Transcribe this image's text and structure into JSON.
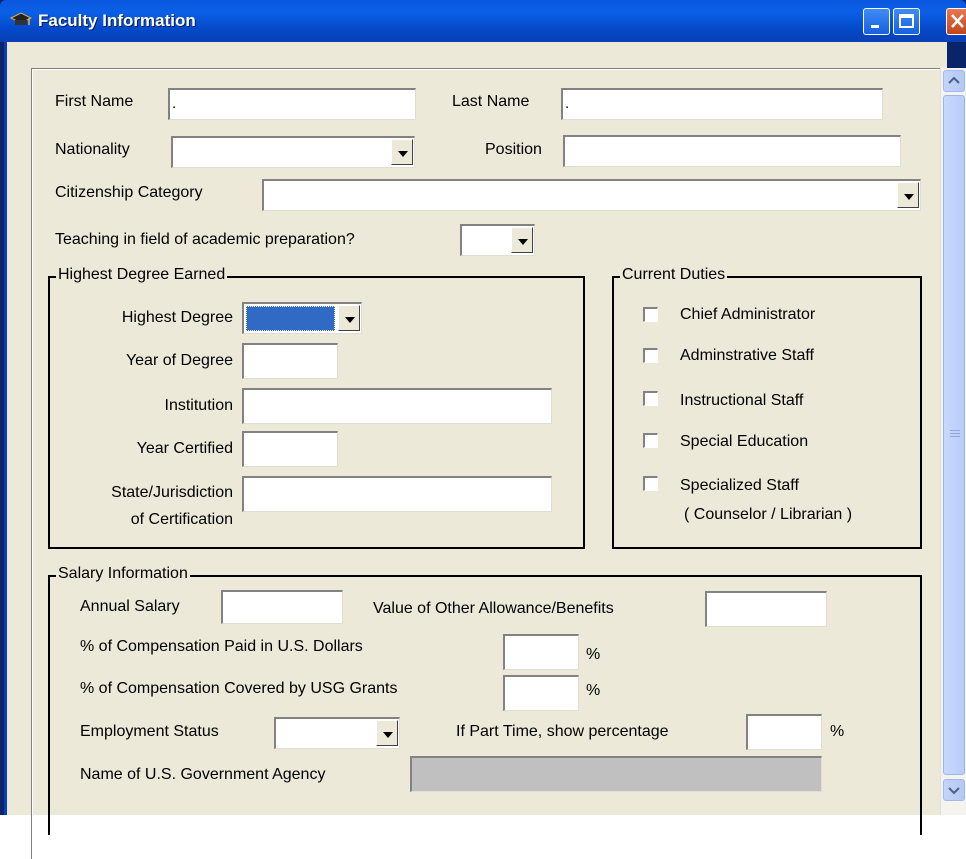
{
  "window": {
    "title": "Faculty Information",
    "icon": "graduation-cap-icon"
  },
  "fields": {
    "first_name": {
      "label": "First Name",
      "value": "."
    },
    "last_name": {
      "label": "Last Name",
      "value": "."
    },
    "nationality": {
      "label": "Nationality",
      "value": ""
    },
    "position": {
      "label": "Position",
      "value": ""
    },
    "citizenship": {
      "label": "Citizenship Category",
      "value": ""
    },
    "teaching_field": {
      "label": "Teaching in field of academic preparation?",
      "value": ""
    }
  },
  "degree": {
    "title": "Highest Degree Earned",
    "highest_degree": {
      "label": "Highest Degree",
      "value": ""
    },
    "year_of_degree": {
      "label": "Year of Degree",
      "value": ""
    },
    "institution": {
      "label": "Institution",
      "value": ""
    },
    "year_certified": {
      "label": "Year Certified",
      "value": ""
    },
    "state_line1": "State/Jurisdiction",
    "state_line2": "of Certification",
    "state_value": ""
  },
  "duties": {
    "title": "Current Duties",
    "items": [
      {
        "label": "Chief Administrator"
      },
      {
        "label": "Adminstrative Staff"
      },
      {
        "label": "Instructional Staff"
      },
      {
        "label": "Special Education"
      },
      {
        "label": "Specialized Staff",
        "sub": "( Counselor / Librarian )"
      }
    ]
  },
  "salary": {
    "title": "Salary Information",
    "annual_salary": {
      "label": "Annual Salary",
      "value": ""
    },
    "other_allowance": {
      "label": "Value of Other Allowance/Benefits",
      "value": ""
    },
    "usd_pct": {
      "label": "% of Compensation Paid in U.S. Dollars",
      "value": "",
      "unit": "%"
    },
    "usg_pct": {
      "label": "% of Compensation Covered by USG Grants",
      "value": "",
      "unit": "%"
    },
    "employment_status": {
      "label": "Employment Status",
      "value": ""
    },
    "part_time": {
      "label": "If Part Time, show percentage",
      "value": "",
      "unit": "%"
    },
    "agency": {
      "label": "Name of U.S. Government Agency",
      "value": ""
    }
  },
  "colors": {
    "titlebar": "#0b5fe6",
    "window_bg": "#ece9d8",
    "selection": "#316ac5"
  }
}
